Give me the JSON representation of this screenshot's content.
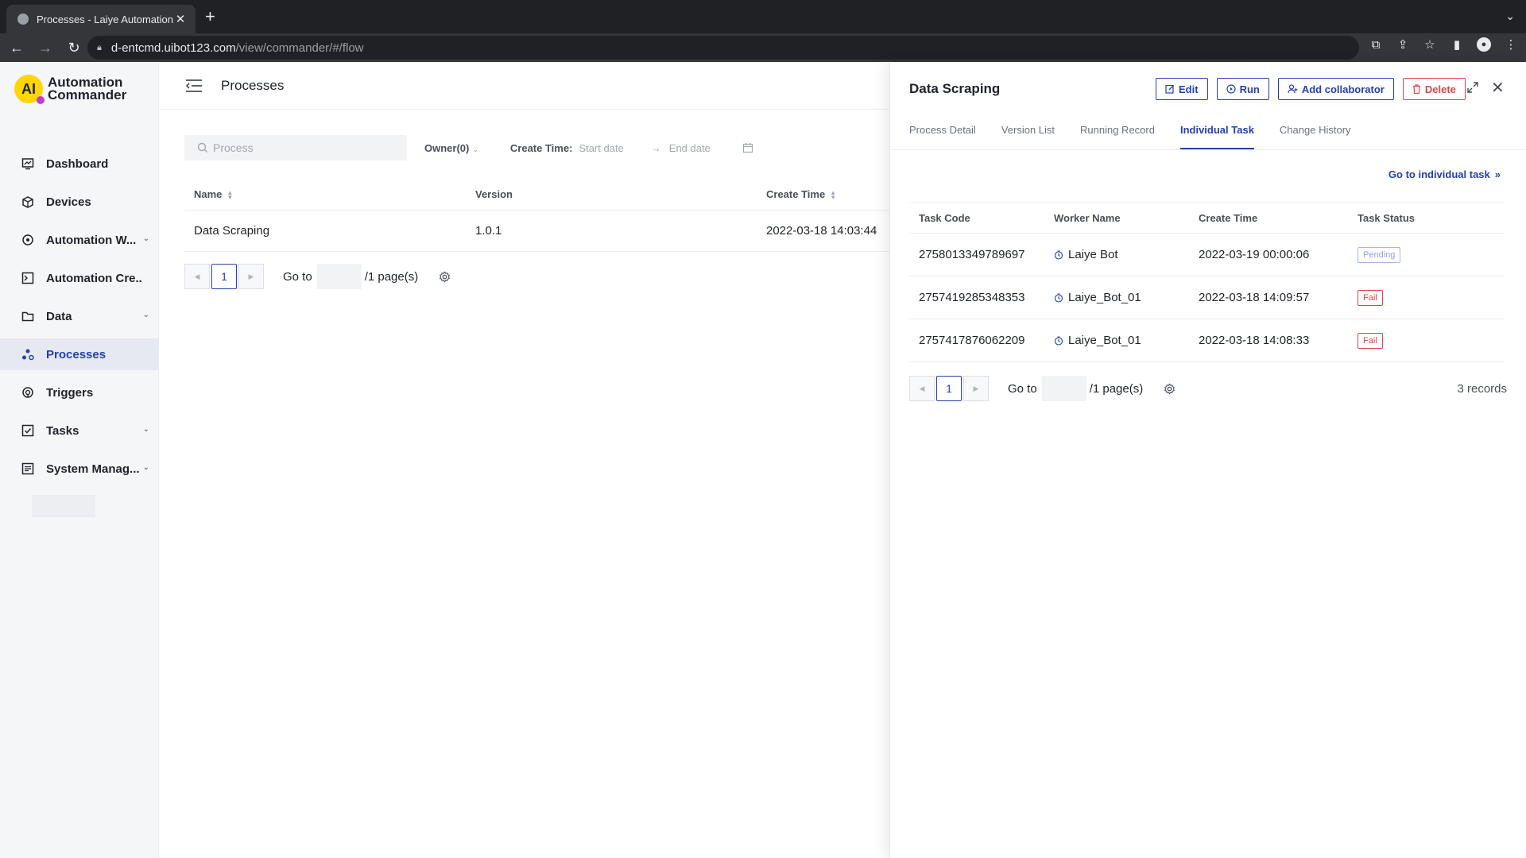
{
  "browser": {
    "tab_title": "Processes - Laiye Automation",
    "url_host": "d-entcmd.uibot123.com",
    "url_path": "/view/commander/#/flow"
  },
  "app": {
    "logo_mark": "AI",
    "logo_line1": "Automation",
    "logo_line2": "Commander",
    "brand_color": "#2440b3",
    "accent_yellow": "#ffd600"
  },
  "sidebar": {
    "items": [
      {
        "label": "Dashboard",
        "icon": "dashboard-icon"
      },
      {
        "label": "Devices",
        "icon": "devices-icon"
      },
      {
        "label": "Automation W...",
        "icon": "automation-worker-icon"
      },
      {
        "label": "Automation Cre...",
        "icon": "automation-creator-icon"
      },
      {
        "label": "Data",
        "icon": "data-folder-icon"
      },
      {
        "label": "Processes",
        "icon": "processes-icon"
      },
      {
        "label": "Triggers",
        "icon": "triggers-icon"
      },
      {
        "label": "Tasks",
        "icon": "tasks-icon"
      },
      {
        "label": "System Manag...",
        "icon": "system-management-icon"
      }
    ]
  },
  "main": {
    "title": "Processes",
    "search_placeholder": "Process",
    "owner_filter": "Owner(0)",
    "create_time_label": "Create Time:",
    "start_date_placeholder": "Start date",
    "end_date_placeholder": "End date",
    "columns": [
      "Name",
      "Version",
      "Create Time"
    ],
    "rows": [
      {
        "name": "Data Scraping",
        "version": "1.0.1",
        "create_time": "2022-03-18 14:03:44"
      }
    ],
    "pager": {
      "current": "1",
      "goto_label": "Go to",
      "pages_label": "/1 page(s)"
    }
  },
  "drawer": {
    "title": "Data Scraping",
    "actions": {
      "edit": "Edit",
      "run": "Run",
      "add_collaborator": "Add collaborator",
      "delete": "Delete"
    },
    "tabs": [
      "Process Detail",
      "Version List",
      "Running Record",
      "Individual Task",
      "Change History"
    ],
    "active_tab": "Individual Task",
    "goto_link": "Go to individual task",
    "columns": [
      "Task Code",
      "Worker Name",
      "Create Time",
      "Task Status"
    ],
    "rows": [
      {
        "code": "2758013349789697",
        "worker": "Laiye Bot",
        "create_time": "2022-03-19 00:00:06",
        "status": "Pending"
      },
      {
        "code": "2757419285348353",
        "worker": "Laiye_Bot_01",
        "create_time": "2022-03-18 14:09:57",
        "status": "Fail"
      },
      {
        "code": "2757417876062209",
        "worker": "Laiye_Bot_01",
        "create_time": "2022-03-18 14:08:33",
        "status": "Fail"
      }
    ],
    "pager": {
      "current": "1",
      "goto_label": "Go to",
      "pages_label": "/1 page(s)"
    },
    "records": "3 records",
    "status_colors": {
      "pending": "#8fa3d9",
      "fail": "#e0454a"
    }
  }
}
